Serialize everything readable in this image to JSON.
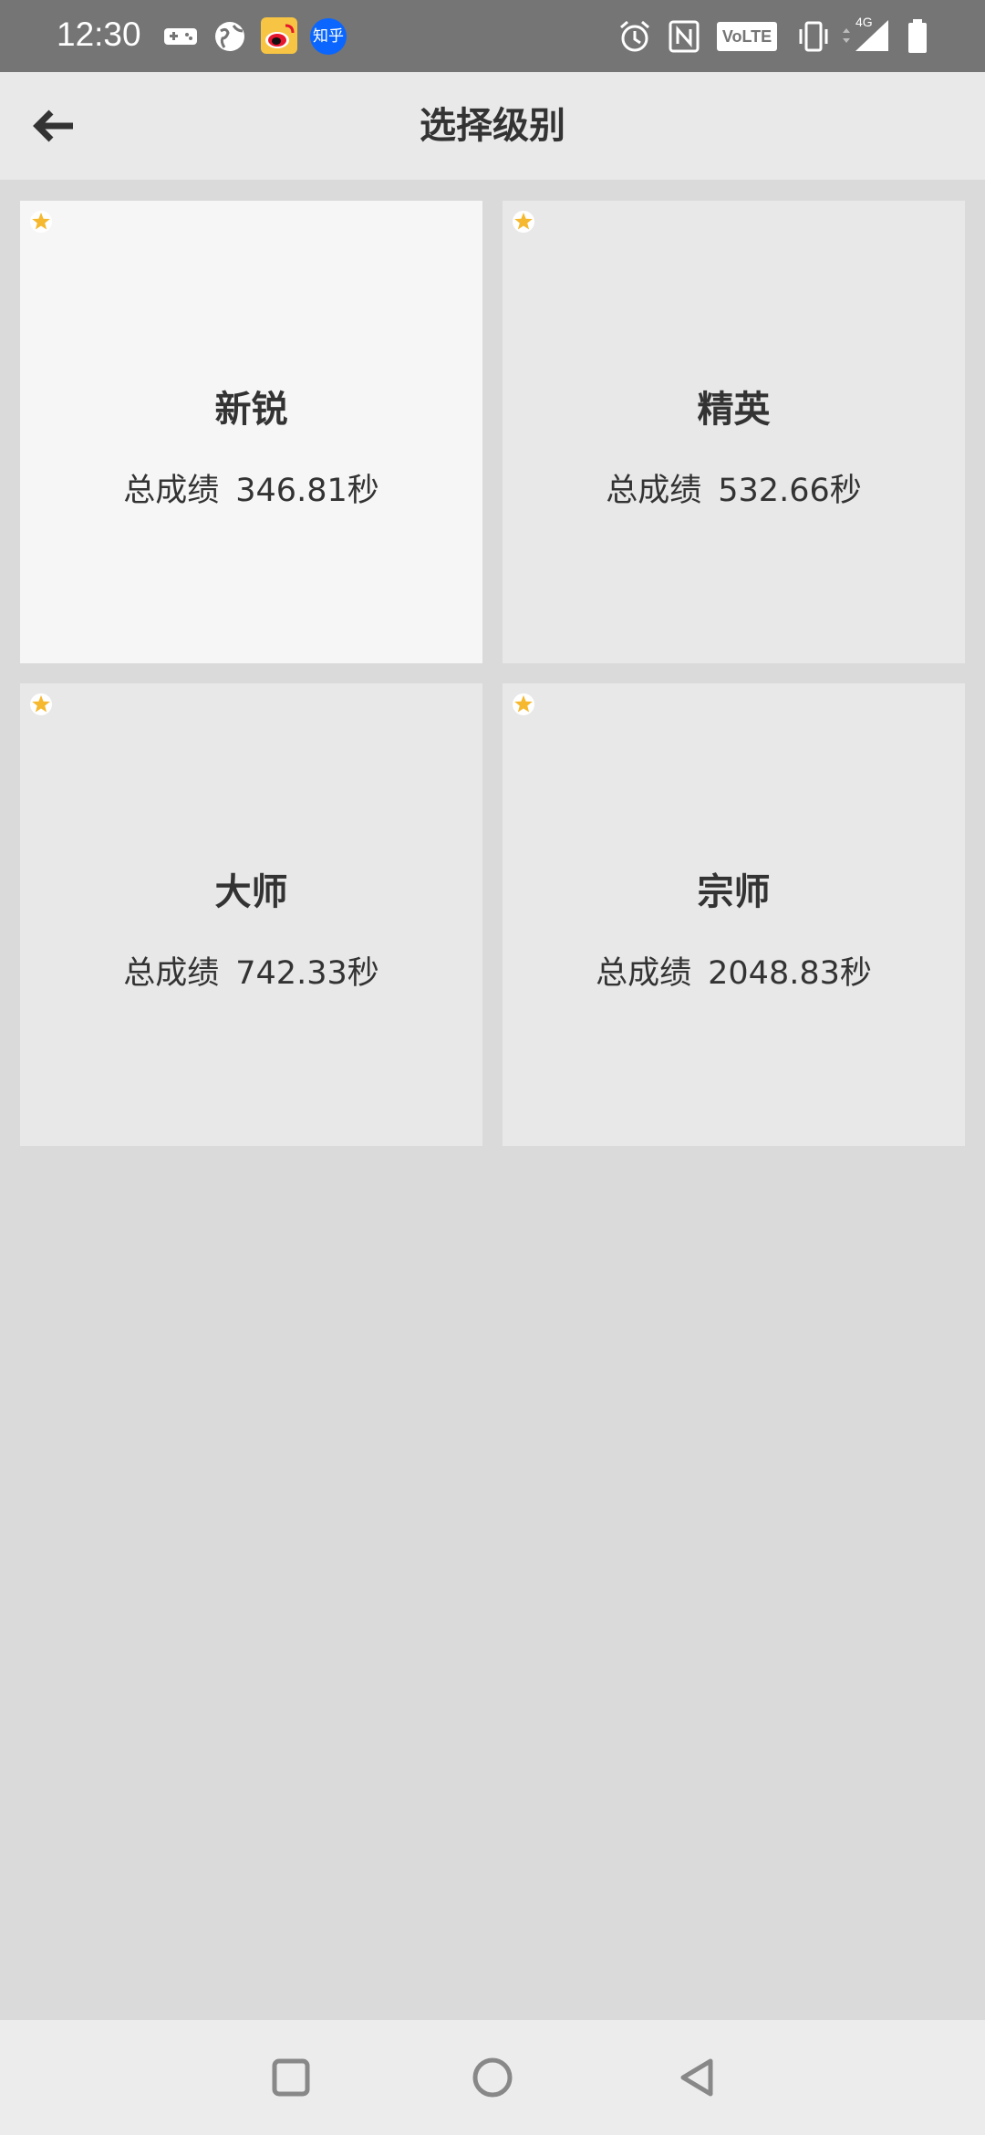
{
  "status_bar": {
    "time": "12:30",
    "left_icons": [
      "gamepad-icon",
      "globe-icon",
      "weibo-icon",
      "zhihu-icon"
    ],
    "zhihu_label": "知乎",
    "right_icons": [
      "alarm-icon",
      "nfc-icon",
      "volte-icon",
      "vibrate-icon",
      "signal-icon",
      "battery-icon"
    ],
    "volte_label": "VoLTE",
    "network_label": "4G"
  },
  "app_bar": {
    "back_icon": "arrow-left-icon",
    "title": "选择级别"
  },
  "levels": [
    {
      "name": "新锐",
      "score_label": "总成绩",
      "score": "346.81秒",
      "selected": true
    },
    {
      "name": "精英",
      "score_label": "总成绩",
      "score": "532.66秒",
      "selected": false
    },
    {
      "name": "大师",
      "score_label": "总成绩",
      "score": "742.33秒",
      "selected": false
    },
    {
      "name": "宗师",
      "score_label": "总成绩",
      "score": "2048.83秒",
      "selected": false
    }
  ],
  "nav_bar": {
    "buttons": [
      "recents-square-icon",
      "home-circle-icon",
      "back-triangle-icon"
    ]
  },
  "colors": {
    "star": "#f5b82e",
    "status_bar": "#757575",
    "app_bar": "#e9e9e9",
    "background": "#dadada",
    "card": "#e8e8e8",
    "card_selected": "#f6f6f6",
    "text": "#333333"
  }
}
